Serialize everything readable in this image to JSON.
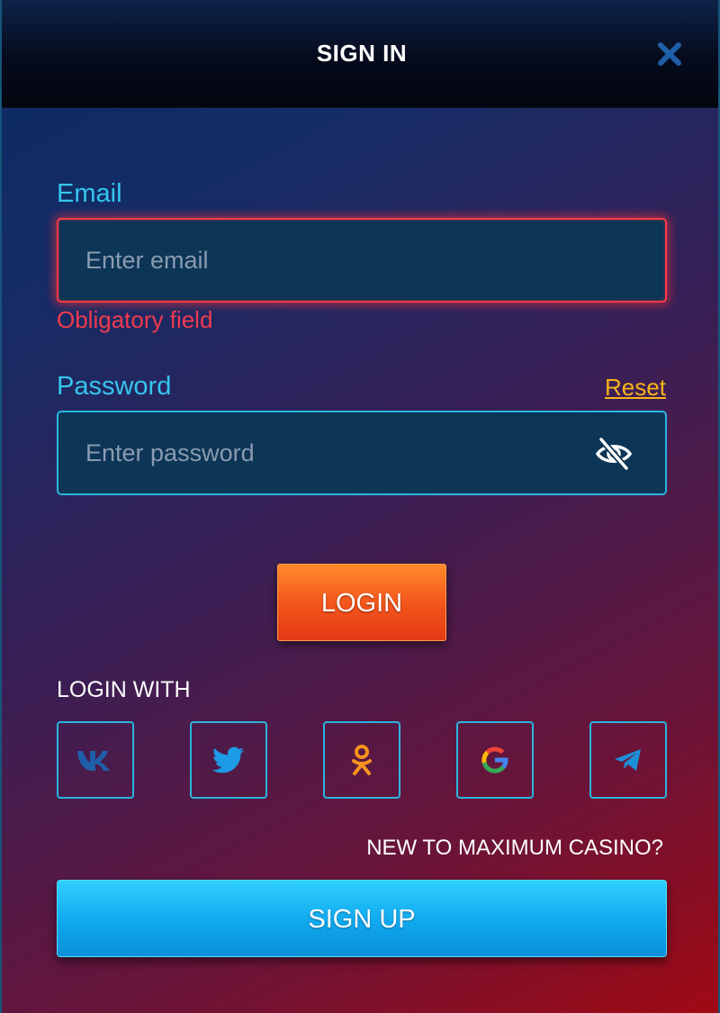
{
  "header": {
    "title": "SIGN IN",
    "close_icon": "close-icon"
  },
  "email": {
    "label": "Email",
    "placeholder": "Enter email",
    "value": "",
    "error": "Obligatory field"
  },
  "password": {
    "label": "Password",
    "placeholder": "Enter password",
    "value": "",
    "reset_label": "Reset",
    "toggle_icon": "eye-slash-icon"
  },
  "login_button": "LOGIN",
  "social": {
    "heading": "LOGIN WITH",
    "providers": [
      {
        "name": "vk",
        "icon": "vk-icon"
      },
      {
        "name": "twitter",
        "icon": "twitter-icon"
      },
      {
        "name": "odnoklassniki",
        "icon": "odnoklassniki-icon"
      },
      {
        "name": "google",
        "icon": "google-icon"
      },
      {
        "name": "telegram",
        "icon": "telegram-icon"
      }
    ]
  },
  "signup": {
    "prompt": "NEW TO MAXIMUM CASINO?",
    "button": "SIGN UP"
  },
  "colors": {
    "accent": "#2bb5de",
    "label": "#35c6ee",
    "error": "#f03b4e",
    "link": "#f6b31c",
    "login_button": "#f3531b",
    "signup_button": "#10a8ee"
  }
}
